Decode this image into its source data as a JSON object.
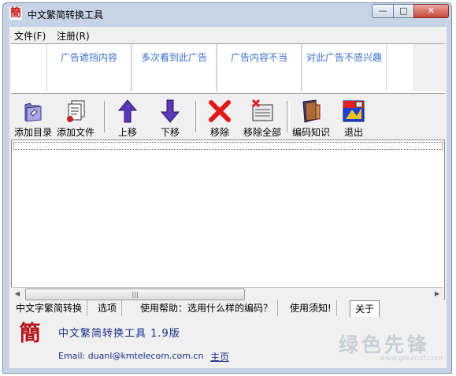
{
  "window": {
    "title": "中文繁简转换工具",
    "icon_char": "簡",
    "controls": {
      "minimize": "—",
      "maximize": "□",
      "close": "✕"
    }
  },
  "menu": [
    {
      "label": "文件(F)"
    },
    {
      "label": "注册(R)"
    }
  ],
  "ads": [
    {
      "label": "广告遮挡内容"
    },
    {
      "label": "多次看到此广告"
    },
    {
      "label": "广告内容不当"
    },
    {
      "label": "对此广告不感兴趣"
    }
  ],
  "toolbar": [
    {
      "label": "添加目录",
      "icon": "folder-icon"
    },
    {
      "label": "添加文件",
      "icon": "files-icon"
    },
    {
      "label": "上移",
      "icon": "arrow-up-icon"
    },
    {
      "label": "下移",
      "icon": "arrow-down-icon"
    },
    {
      "label": "移除",
      "icon": "red-x-icon"
    },
    {
      "label": "移除全部",
      "icon": "remove-all-icon"
    },
    {
      "label": "编码知识",
      "icon": "book-icon"
    },
    {
      "label": "退出",
      "icon": "exit-icon"
    }
  ],
  "scrollbar": {
    "left_arrow": "◀",
    "right_arrow": "▶",
    "thumb_grip": "|||"
  },
  "tabs": [
    {
      "label": "中文字繁简转换"
    },
    {
      "label": "选项"
    },
    {
      "label": "使用帮助：选用什么样的编码？"
    },
    {
      "label": "使用须知!"
    },
    {
      "label": "关于",
      "active": true
    }
  ],
  "about": {
    "icon_char": "簡",
    "title": "中文繁简转换工具 1.9版",
    "email": "Email: duanl@kmtelecom.com.cn",
    "homepage": "主页"
  },
  "watermark": {
    "text": "绿色先锋",
    "url": "www.greenxf.com"
  },
  "colors": {
    "link": "#1a2f8a",
    "ad_text": "#3b6fce",
    "title_bar": "#c6d4e6"
  }
}
